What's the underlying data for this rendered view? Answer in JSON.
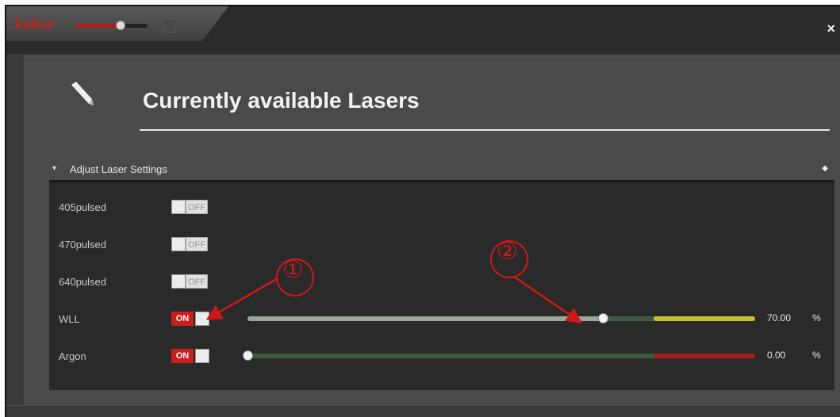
{
  "window": {
    "logo_text": "Leica",
    "close_icon": "×"
  },
  "header": {
    "title": "Currently available Lasers"
  },
  "section": {
    "title": "Adjust Laser Settings",
    "collapse_icon": "▾",
    "pin_icon": "◆"
  },
  "lasers": [
    {
      "label": "405pulsed",
      "state": "OFF"
    },
    {
      "label": "470pulsed",
      "state": "OFF"
    },
    {
      "label": "640pulsed",
      "state": "OFF"
    },
    {
      "label": "WLL",
      "state": "ON",
      "value": "70.00",
      "unit": "%",
      "level_fraction": 0.7,
      "warn_color": "#c8c030"
    },
    {
      "label": "Argon",
      "state": "ON",
      "value": "0.00",
      "unit": "%",
      "level_fraction": 0.0,
      "warn_color": "#a01c1c"
    }
  ],
  "annotations": [
    {
      "label": "①"
    },
    {
      "label": "②"
    }
  ],
  "colors": {
    "on_red": "#c81e1e",
    "annotation_red": "#d01818"
  }
}
